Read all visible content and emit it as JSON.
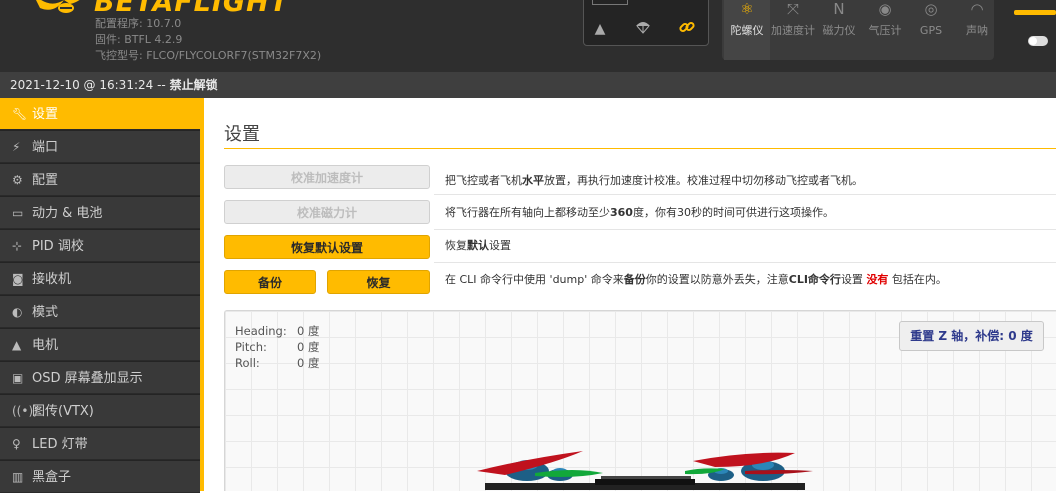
{
  "header": {
    "brand": "BETAFLIGHT",
    "configurator_version": "配置程序: 10.7.0",
    "firmware_version": "固件: BTFL 4.2.9",
    "board": "飞控型号: FLCO/FLYCOLORF7(STM32F7X2)",
    "link_icons": [
      "warning-icon",
      "parachute-icon",
      "link-icon"
    ],
    "sensors": [
      {
        "label": "陀螺仪",
        "icon": "gyro-icon",
        "active": true
      },
      {
        "label": "加速度计",
        "icon": "accel-icon",
        "active": false
      },
      {
        "label": "磁力仪",
        "icon": "mag-icon",
        "active": false
      },
      {
        "label": "气压计",
        "icon": "baro-icon",
        "active": false
      },
      {
        "label": "GPS",
        "icon": "gps-icon",
        "active": false
      },
      {
        "label": "声呐",
        "icon": "sonar-icon",
        "active": false
      }
    ]
  },
  "status": {
    "datetime": "2021-12-10 @ 16:31:24",
    "separator": " -- ",
    "arming": "禁止解锁"
  },
  "sidebar": {
    "items": [
      {
        "label": "设置",
        "icon": "wrench-icon"
      },
      {
        "label": "端口",
        "icon": "plug-icon"
      },
      {
        "label": "配置",
        "icon": "gear-icon"
      },
      {
        "label": "动力 & 电池",
        "icon": "battery-icon"
      },
      {
        "label": "PID 调校",
        "icon": "sitemap-icon"
      },
      {
        "label": "接收机",
        "icon": "receiver-icon"
      },
      {
        "label": "模式",
        "icon": "toggles-icon"
      },
      {
        "label": "电机",
        "icon": "motor-icon"
      },
      {
        "label": "OSD 屏幕叠加显示",
        "icon": "osd-icon"
      },
      {
        "label": "图传(VTX)",
        "icon": "vtx-icon"
      },
      {
        "label": "LED 灯带",
        "icon": "led-icon"
      },
      {
        "label": "黑盒子",
        "icon": "blackbox-icon"
      }
    ]
  },
  "main": {
    "title": "设置",
    "calibrate_acc": {
      "label": "校准加速度计",
      "desc_pre": "把飞控或者飞机",
      "desc_bold": "水平",
      "desc_post": "放置，再执行加速度计校准。校准过程中切勿移动飞控或者飞机。"
    },
    "calibrate_mag": {
      "label": "校准磁力计",
      "desc_pre": "将飞行器在所有轴向上都移动至少",
      "desc_bold": "360",
      "desc_post": "度，你有30秒的时间可供进行这项操作。"
    },
    "reset_defaults": {
      "label": "恢复默认设置",
      "desc_pre": "恢复",
      "desc_bold": "默认",
      "desc_post": "设置"
    },
    "backup_restore": {
      "backup_label": "备份",
      "restore_label": "恢复",
      "desc_1": "在 CLI 命令行中使用 'dump' 命令来",
      "desc_2": "备份",
      "desc_3": "你的设置以防意外丢失，注意",
      "desc_4": "CLI命令行",
      "desc_5": "设置 ",
      "desc_6": "没有",
      "desc_7": " 包括在内。"
    },
    "attitude": {
      "heading_label": "Heading:",
      "heading_value": "0 度",
      "pitch_label": "Pitch:",
      "pitch_value": "0 度",
      "roll_label": "Roll:",
      "roll_value": "0 度"
    },
    "reset_z_label": "重置 Z 轴，补偿: 0 度"
  },
  "colors": {
    "accent": "#ffbb00",
    "header_bg": "#2e2e2e",
    "sidebar_bg": "#393939",
    "warning_red": "#e00000",
    "reset_text": "#2e3a8c"
  }
}
